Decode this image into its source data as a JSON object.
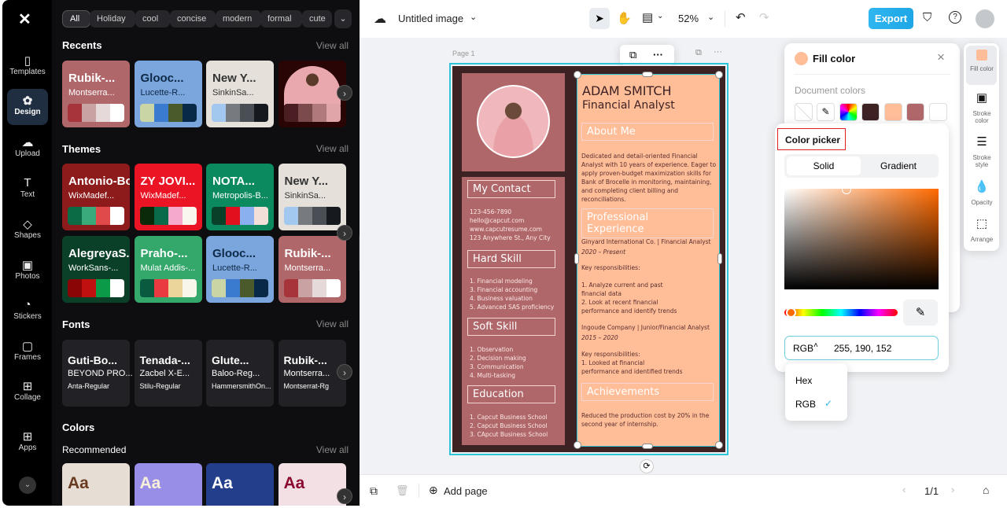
{
  "nav": {
    "items": [
      {
        "label": "Templates",
        "icon": "templates-icon",
        "glyph": "▯"
      },
      {
        "label": "Design",
        "icon": "design-icon",
        "glyph": "✿",
        "active": true
      },
      {
        "label": "Upload",
        "icon": "upload-cloud-icon",
        "glyph": "☁"
      },
      {
        "label": "Text",
        "icon": "text-icon",
        "glyph": "T"
      },
      {
        "label": "Shapes",
        "icon": "shapes-icon",
        "glyph": "◇"
      },
      {
        "label": "Photos",
        "icon": "photos-icon",
        "glyph": "▣"
      },
      {
        "label": "Stickers",
        "icon": "stickers-icon",
        "glyph": "◔"
      },
      {
        "label": "Frames",
        "icon": "frames-icon",
        "glyph": "▢"
      },
      {
        "label": "Collage",
        "icon": "collage-icon",
        "glyph": "⊞"
      },
      {
        "label": "Apps",
        "icon": "apps-icon",
        "glyph": "⊞"
      }
    ]
  },
  "panel": {
    "chips": [
      "All",
      "Holiday",
      "cool",
      "concise",
      "modern",
      "formal",
      "cute"
    ],
    "recents_title": "Recents",
    "themes_title": "Themes",
    "fonts_title": "Fonts",
    "colors_title": "Colors",
    "recommended_title": "Recommended",
    "view_all": "View all",
    "recents": [
      {
        "t": "Rubik-...",
        "s": "Montserra...",
        "bg": "#b0676a",
        "fg": "#fff",
        "sw": [
          "#a7343a",
          "#c9a3a3",
          "#e5d9d9",
          "#ffffff"
        ]
      },
      {
        "t": "Glooc...",
        "s": "Lucette-R...",
        "bg": "#7aa6dd",
        "fg": "#0f2a48",
        "sw": [
          "#c9d5a5",
          "#3a7bd0",
          "#4a5a2a",
          "#082a48"
        ]
      },
      {
        "t": "New Y...",
        "s": "SinkinSa...",
        "bg": "#e5e0da",
        "fg": "#333",
        "sw": [
          "#a3c8f0",
          "#777b80",
          "#4a4e55",
          "#16191e"
        ]
      },
      {
        "t": "",
        "s": "",
        "bg": "#2a0505",
        "fg": "#fff",
        "sw": [
          "#4a1e22",
          "#7a4a4c",
          "#b07a7c",
          "#e0a5a8"
        ],
        "photo": true
      }
    ],
    "themes": [
      {
        "t": "Antonio-Bold",
        "s": "WixMadef...",
        "bg": "#8e1b1b",
        "fg": "#fff",
        "sw": [
          "#0a6b44",
          "#3aaa7a",
          "#e04a4a",
          "#ffffff"
        ]
      },
      {
        "t": "ZY JOVI...",
        "s": "WixMadef...",
        "bg": "#ea1425",
        "fg": "#fff",
        "sw": [
          "#0a2a0a",
          "#0a6b4a",
          "#f5aacc",
          "#f9f6ee"
        ]
      },
      {
        "t": "NOTA...",
        "s": "Metropolis-B...",
        "bg": "#0a8a5e",
        "fg": "#fff",
        "sw": [
          "#08402a",
          "#e0101e",
          "#8ab0f0",
          "#f2e0d8"
        ]
      },
      {
        "t": "New Y...",
        "s": "SinkinSa...",
        "bg": "#e5e0da",
        "fg": "#333",
        "sw": [
          "#a3c8f0",
          "#777b80",
          "#4a4e55",
          "#16191e"
        ]
      },
      {
        "t": "AlegreyaS...",
        "s": "WorkSans-...",
        "bg": "#0a4028",
        "fg": "#fff",
        "sw": [
          "#8a0505",
          "#c01010",
          "#0a9a48",
          "#ffffff"
        ]
      },
      {
        "t": "Praho-...",
        "s": "Mulat Addis-...",
        "bg": "#33a86a",
        "fg": "#fff",
        "sw": [
          "#0a5a40",
          "#e83a40",
          "#ecd59a",
          "#f8f6ea"
        ]
      },
      {
        "t": "Glooc...",
        "s": "Lucette-R...",
        "bg": "#7aa6dd",
        "fg": "#0f2a48",
        "sw": [
          "#c9d5a5",
          "#3a7bd0",
          "#4a5a2a",
          "#082a48"
        ]
      },
      {
        "t": "Rubik-...",
        "s": "Montserra...",
        "bg": "#b0676a",
        "fg": "#fff",
        "sw": [
          "#a7343a",
          "#c9a3a3",
          "#e5d9d9",
          "#ffffff"
        ]
      }
    ],
    "fonts": [
      {
        "a": "Guti-Bo...",
        "b": "BEYOND PRO...",
        "c": "Anta-Regular"
      },
      {
        "a": "Tenada-...",
        "b": "Zacbel X-E...",
        "c": "Stilu-Regular"
      },
      {
        "a": "Glute...",
        "b": "Baloo-Reg...",
        "c": "HammersmithOn..."
      },
      {
        "a": "Rubik-...",
        "b": "Montserra...",
        "c": "Montserrat-Rg"
      }
    ],
    "colors": [
      {
        "label": "Aa",
        "bg": "#e6ddd5",
        "fg": "#6a3a20"
      },
      {
        "label": "Aa",
        "bg": "#988ee8",
        "fg": "#f8f0d8"
      },
      {
        "label": "Aa",
        "bg": "#233e8a",
        "fg": "#ffffff"
      },
      {
        "label": "Aa",
        "bg": "#f3e0e4",
        "fg": "#8a0a30"
      }
    ]
  },
  "topbar": {
    "title": "Untitled image",
    "zoom": "52%",
    "export": "Export"
  },
  "canvas": {
    "page_label": "Page 1"
  },
  "resume": {
    "name": "ADAM SMITCH",
    "role": "Financial Analyst",
    "about_h": "About Me",
    "about": "Dedicated and detail-oriented Financial Analyst with 10 years of experience. Eager to apply proven-budget maximization skills for Bank of Brocelle in monitoring, maintaining, and completing client billing and reconciliations.",
    "exp_h": "Professional Experience",
    "job1": "Ginyard International Co. | Financial Analyst",
    "job1_date": "2020 – Present",
    "job1_resp": "Key responsibilities:\n\n1. Analyze current and past\nfinancial data\n2. Look at recent financial\nperformance and identify trends",
    "job2": "Ingoude Company | Junior/Financial Analyst",
    "job2_date": "2015 – 2020",
    "job2_resp": "Key responsibilities:\n1. Looked at financial\nperformance and identified trends",
    "ach_h": "Achievements",
    "ach": "Reduced the production cost by 20% in the second year of internship.",
    "contact_h": "My Contact",
    "contact": "123-456-7890\nhello@capcut.com\nwww.capcutresume.com\n123 Anywhere St., Any City",
    "hard_h": "Hard Skill",
    "hard": "1. Financial modeling\n3. Financial accounting\n4. Business valuation\n5. Advanced SAS proficiency",
    "soft_h": "Soft Skill",
    "soft": "1. Observation\n2. Decision making\n3. Communication\n4. Multi-tasking",
    "edu_h": "Education",
    "edu": "1. Capcut Business School\n2. Capcut Business School\n3. CApcut Business School",
    "colors": {
      "dark": "#3d2224",
      "rose": "#b0676a",
      "peach": "#ffbd98"
    }
  },
  "fill": {
    "title": "Fill color",
    "doc_colors": "Document colors",
    "current": "#ffbe98",
    "swatches": [
      "none",
      "eyedropper",
      "rainbow",
      "#3d2224",
      "#ffbd98",
      "#b0676a",
      "#ffffff"
    ]
  },
  "picker": {
    "title": "Color picker",
    "solid": "Solid",
    "gradient": "Gradient",
    "mode": "RGB",
    "value": "255, 190, 152",
    "hue": "#ff6a00",
    "options": [
      "Hex",
      "RGB"
    ],
    "selected": "RGB"
  },
  "righttools": [
    {
      "label": "Fill color",
      "icon": "fill-color-icon"
    },
    {
      "label": "Stroke color",
      "icon": "stroke-color-icon"
    },
    {
      "label": "Stroke style",
      "icon": "stroke-style-icon"
    },
    {
      "label": "Opacity",
      "icon": "opacity-icon"
    },
    {
      "label": "Arrange",
      "icon": "arrange-icon"
    }
  ],
  "bottombar": {
    "add_page": "Add page",
    "page_count": "1/1"
  }
}
